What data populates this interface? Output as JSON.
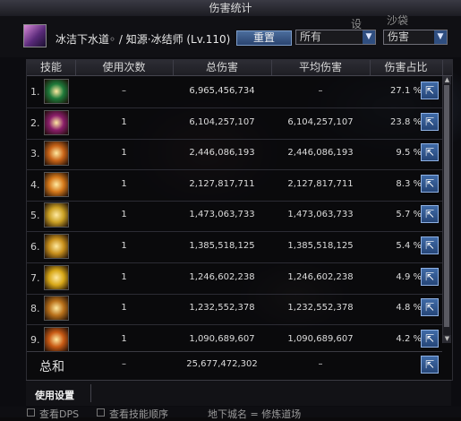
{
  "window": {
    "title": "伤害统计"
  },
  "header": {
    "character": "冰洁下水道◦ / 知源·冰结师 (Lv.110)",
    "reset_label": "重置",
    "filter_all": "所有",
    "filter_damage": "伤害"
  },
  "background_text": {
    "topleft_a": "设",
    "topright_a": "沙袋",
    "bottom_area": "地下城名 = 修炼道场"
  },
  "table": {
    "headers": [
      "技能",
      "使用次数",
      "总伤害",
      "平均伤害",
      "伤害占比"
    ],
    "rows": [
      {
        "rank": "1.",
        "uses": "–",
        "total": "6,965,456,734",
        "avg": "–",
        "pct": "27.1 %",
        "icon": "green-cross-skill-icon",
        "color": "#1e7a3a"
      },
      {
        "rank": "2.",
        "uses": "1",
        "total": "6,104,257,107",
        "avg": "6,104,257,107",
        "pct": "23.8 %",
        "icon": "purple-burst-skill-icon",
        "color": "#8a1e6a"
      },
      {
        "rank": "3.",
        "uses": "1",
        "total": "2,446,086,193",
        "avg": "2,446,086,193",
        "pct": "9.5 %",
        "icon": "fire-skill-icon",
        "color": "#c86418"
      },
      {
        "rank": "4.",
        "uses": "1",
        "total": "2,127,817,711",
        "avg": "2,127,817,711",
        "pct": "8.3 %",
        "icon": "flame-wave-skill-icon",
        "color": "#d4781a"
      },
      {
        "rank": "5.",
        "uses": "1",
        "total": "1,473,063,733",
        "avg": "1,473,063,733",
        "pct": "5.7 %",
        "icon": "golden-slash-skill-icon",
        "color": "#caa024"
      },
      {
        "rank": "6.",
        "uses": "1",
        "total": "1,385,518,125",
        "avg": "1,385,518,125",
        "pct": "5.4 %",
        "icon": "lightning-skill-icon",
        "color": "#c8901c"
      },
      {
        "rank": "7.",
        "uses": "1",
        "total": "1,246,602,238",
        "avg": "1,246,602,238",
        "pct": "4.9 %",
        "icon": "flash-skill-icon",
        "color": "#d8a818"
      },
      {
        "rank": "8.",
        "uses": "1",
        "total": "1,232,552,378",
        "avg": "1,232,552,378",
        "pct": "4.8 %",
        "icon": "sun-skill-icon",
        "color": "#b8701a"
      },
      {
        "rank": "9.",
        "uses": "1",
        "total": "1,090,689,607",
        "avg": "1,090,689,607",
        "pct": "4.2 %",
        "icon": "blaze-skill-icon",
        "color": "#c85a14"
      }
    ],
    "total": {
      "label": "总和",
      "uses": "–",
      "total": "25,677,472,302",
      "avg": "–"
    }
  },
  "settings": {
    "label": "使用设置"
  },
  "bottom": {
    "option1": "查看DPS",
    "option2": "查看技能顺序"
  }
}
